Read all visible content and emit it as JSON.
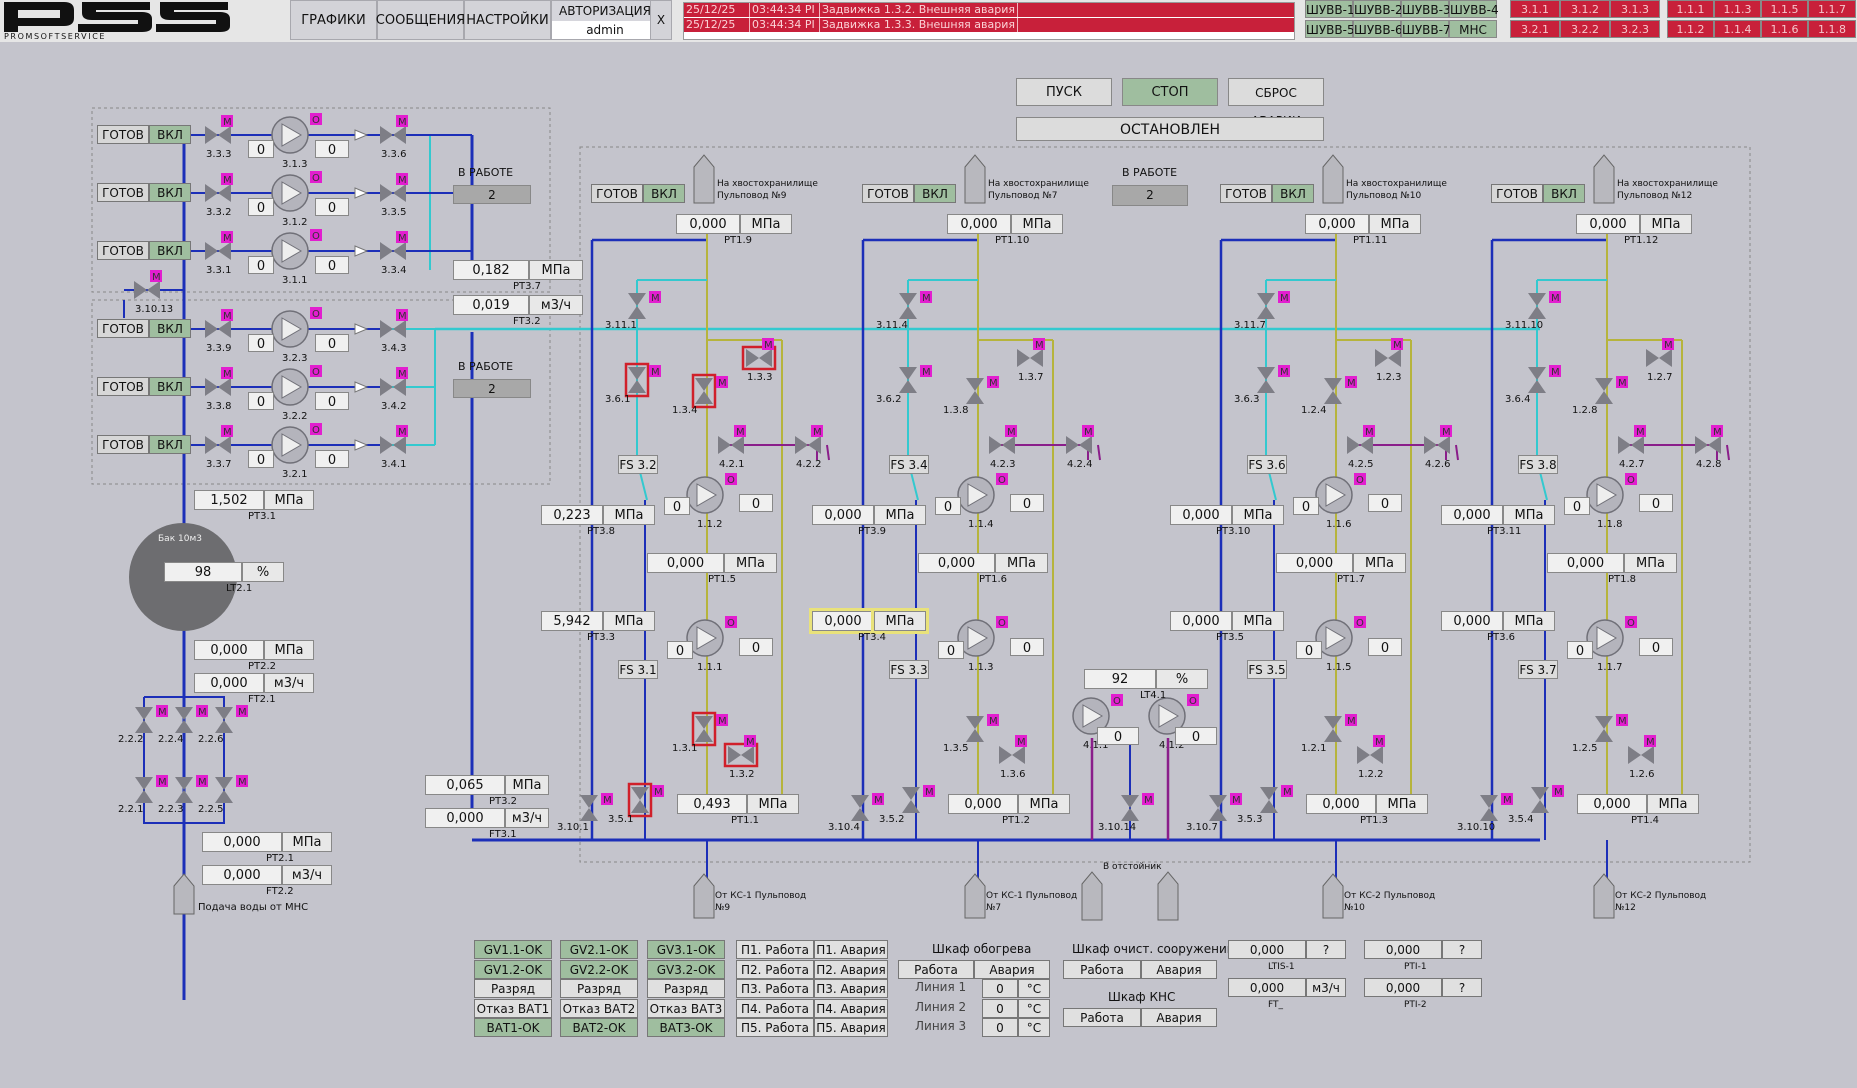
{
  "logo": {
    "text": "PSS",
    "sub": "PROMSOFTSERVICE"
  },
  "menu": {
    "graphs": "ГРАФИКИ",
    "messages": "СООБЩЕНИЯ",
    "settings": "НАСТРОЙКИ",
    "auth_label": "АВТОРИЗАЦИЯ",
    "user": "admin",
    "close": "X"
  },
  "alarms": [
    {
      "date": "25/12/25",
      "time": "03:44:34 PI",
      "text": "Задвижка 1.3.2. Внешняя авария"
    },
    {
      "date": "25/12/25",
      "time": "03:44:34 PI",
      "text": "Задвижка 1.3.3. Внешняя авария"
    }
  ],
  "shuvv": [
    [
      "ШУВВ-1",
      "ШУВВ-2",
      "ШУВВ-3",
      "ШУВВ-4"
    ],
    [
      "ШУВВ-5",
      "ШУВВ-6",
      "ШУВВ-7",
      "МНС"
    ]
  ],
  "red_tags_a": [
    [
      "3.1.1",
      "3.1.2",
      "3.1.3"
    ],
    [
      "3.2.1",
      "3.2.2",
      "3.2.3"
    ]
  ],
  "red_tags_b": [
    [
      "1.1.1",
      "1.1.3",
      "1.1.5",
      "1.1.7"
    ],
    [
      "1.1.2",
      "1.1.4",
      "1.1.6",
      "1.1.8"
    ]
  ],
  "control": {
    "start": "ПУСК",
    "stop": "СТОП",
    "reset": "СБРОС АВАРИИ",
    "status": "ОСТАНОВЛЕН"
  },
  "colors": {
    "bg": "#c4c4cc",
    "alarm": "#c8203a",
    "ok": "#9fbe9f",
    "pipe_blue": "#1c2fb8",
    "pipe_cyan": "#33c9cf",
    "pipe_yellow": "#b6b43c",
    "pipe_purple": "#8a1e8a",
    "motor": "#e21ecf"
  },
  "common": {
    "ready": "ГОТОВ",
    "on": "ВКЛ",
    "mpa": "МПа",
    "m3h": "м3/ч",
    "pct": "%",
    "in_work": "В РАБОТЕ",
    "zero_int": "0",
    "q": "?"
  },
  "left_pumps": [
    {
      "valve_in": "3.3.3",
      "pump": "3.1.3",
      "valve_out": "3.3.6"
    },
    {
      "valve_in": "3.3.2",
      "pump": "3.1.2",
      "valve_out": "3.3.5"
    },
    {
      "valve_in": "3.3.1",
      "pump": "3.1.1",
      "valve_out": "3.3.4"
    },
    {
      "valve_in": "3.3.9",
      "pump": "3.2.3",
      "valve_out": "3.4.3"
    },
    {
      "valve_in": "3.3.8",
      "pump": "3.2.2",
      "valve_out": "3.4.2"
    },
    {
      "valve_in": "3.3.7",
      "pump": "3.2.1",
      "valve_out": "3.4.1"
    }
  ],
  "left_misc": {
    "valve_3_10_13": "3.10.13",
    "in_work_1": "2",
    "in_work_2": "2",
    "pt37": {
      "value": "0,182",
      "name": "PT3.7"
    },
    "ft32": {
      "value": "0,019",
      "name": "FT3.2"
    },
    "pt31": {
      "value": "1,502",
      "name": "PT3.1"
    },
    "tank_title": "Бак 10м3",
    "lt21": {
      "value": "98",
      "name": "LT2.1"
    },
    "pt22": {
      "value": "0,000",
      "name": "PT2.2"
    },
    "ft21": {
      "value": "0,000",
      "name": "FT2.1"
    },
    "valves_22": [
      "2.2.2",
      "2.2.4",
      "2.2.6",
      "2.2.1",
      "2.2.3",
      "2.2.5"
    ],
    "pt21": {
      "value": "0,000",
      "name": "PT2.1"
    },
    "ft22": {
      "value": "0,000",
      "name": "FT2.2"
    },
    "supply": "Подача воды от МНС",
    "pt32": {
      "value": "0,065",
      "name": "PT3.2"
    },
    "ft31": {
      "value": "0,000",
      "name": "FT3.1"
    }
  },
  "lines": [
    {
      "dest": "На хвостохранилище Пульповод №9",
      "pt_top": {
        "value": "0,000",
        "name": "PT1.9"
      },
      "v_11": "3.11.1",
      "v_6": "3.6.1",
      "v_ab": [
        "1.3.4",
        "1.3.3"
      ],
      "fs_top": "FS 3.2",
      "v_2x": [
        "4.2.1",
        "4.2.2"
      ],
      "pump_top": "1.1.2",
      "pt_left_top": {
        "value": "0,223",
        "name": "PT3.8"
      },
      "pt_mid": {
        "value": "0,000",
        "name": "PT1.5"
      },
      "pump_bot": "1.1.1",
      "pt_left_bot": {
        "value": "5,942",
        "name": "PT3.3"
      },
      "fs_bot": "FS 3.1",
      "v_bot": [
        "1.3.1",
        "1.3.2"
      ],
      "v_10": "3.10.1",
      "v_5": "3.5.1",
      "pt_bot": {
        "value": "0,493",
        "name": "PT1.1"
      },
      "src": "От КС-1 Пульповод №9"
    },
    {
      "dest": "На хвостохранилище Пульповод №7",
      "pt_top": {
        "value": "0,000",
        "name": "PT1.10"
      },
      "v_11": "3.11.4",
      "v_6": "3.6.2",
      "v_ab": [
        "1.3.8",
        "1.3.7"
      ],
      "fs_top": "FS 3.4",
      "v_2x": [
        "4.2.3",
        "4.2.4"
      ],
      "pump_top": "1.1.4",
      "pt_left_top": {
        "value": "0,000",
        "name": "PT3.9"
      },
      "pt_mid": {
        "value": "0,000",
        "name": "PT1.6"
      },
      "pump_bot": "1.1.3",
      "pt_left_bot": {
        "value": "0,000",
        "name": "PT3.4"
      },
      "fs_bot": "FS 3.3",
      "v_bot": [
        "1.3.5",
        "1.3.6"
      ],
      "v_10": "3.10.4",
      "v_5": "3.5.2",
      "pt_bot": {
        "value": "0,000",
        "name": "PT1.2"
      },
      "src": "От КС-1 Пульповод №7"
    },
    {
      "dest": "На хвостохранилище Пульповод №10",
      "pt_top": {
        "value": "0,000",
        "name": "PT1.11"
      },
      "v_11": "3.11.7",
      "v_6": "3.6.3",
      "v_ab": [
        "1.2.4",
        "1.2.3"
      ],
      "fs_top": "FS 3.6",
      "v_2x": [
        "4.2.5",
        "4.2.6"
      ],
      "pump_top": "1.1.6",
      "pt_left_top": {
        "value": "0,000",
        "name": "PT3.10"
      },
      "pt_mid": {
        "value": "0,000",
        "name": "PT1.7"
      },
      "pump_bot": "1.1.5",
      "pt_left_bot": {
        "value": "0,000",
        "name": "PT3.5"
      },
      "fs_bot": "FS 3.5",
      "v_bot": [
        "1.2.1",
        "1.2.2"
      ],
      "v_10": "3.10.7",
      "v_5": "3.5.3",
      "pt_bot": {
        "value": "0,000",
        "name": "PT1.3"
      },
      "src": "От КС-2 Пульповод №10"
    },
    {
      "dest": "На хвостохранилище Пульповод №12",
      "pt_top": {
        "value": "0,000",
        "name": "PT1.12"
      },
      "v_11": "3.11.10",
      "v_6": "3.6.4",
      "v_ab": [
        "1.2.8",
        "1.2.7"
      ],
      "fs_top": "FS 3.8",
      "v_2x": [
        "4.2.7",
        "4.2.8"
      ],
      "pump_top": "1.1.8",
      "pt_left_top": {
        "value": "0,000",
        "name": "PT3.11"
      },
      "pt_mid": {
        "value": "0,000",
        "name": "PT1.8"
      },
      "pump_bot": "1.1.7",
      "pt_left_bot": {
        "value": "0,000",
        "name": "PT3.6"
      },
      "fs_bot": "FS 3.7",
      "v_bot": [
        "1.2.5",
        "1.2.6"
      ],
      "v_10": "3.10.10",
      "v_5": "3.5.4",
      "pt_bot": {
        "value": "0,000",
        "name": "PT1.4"
      },
      "src": "От КС-2 Пульповод №12"
    }
  ],
  "center": {
    "in_work": "В РАБОТЕ",
    "in_work_val": "2",
    "lt41": {
      "value": "92",
      "name": "LT4.1"
    },
    "pump_a": "4.1.1",
    "pump_b": "4.1.2",
    "valve": "3.10.14",
    "sump": "В отстойник"
  },
  "bottom": {
    "gv": [
      [
        "GV1.1-OK",
        "GV1.2-OK",
        "Разряд ВАТ1",
        "Отказ ВАТ1",
        "ВАТ1-OK"
      ],
      [
        "GV2.1-OK",
        "GV2.2-OK",
        "Разряд ВАТ2",
        "Отказ ВАТ2",
        "ВАТ2-OK"
      ],
      [
        "GV3.1-OK",
        "GV3.2-OK",
        "Разряд ВАТ3",
        "Отказ ВАТ3",
        "ВАТ3-OK"
      ]
    ],
    "p_work": [
      "П1. Работа",
      "П2. Работа",
      "П3. Работа",
      "П4. Работа",
      "П5. Работа"
    ],
    "p_alarm": [
      "П1. Авария",
      "П2. Авария",
      "П3. Авария",
      "П4. Авария",
      "П5. Авария"
    ],
    "heat": {
      "title": "Шкаф обогрева",
      "work": "Работа",
      "alarm": "Авария",
      "lines": [
        "Линия 1",
        "Линия 2",
        "Линия 3"
      ],
      "vals": [
        "0",
        "0",
        "0"
      ],
      "unit": "°C"
    },
    "clean": {
      "title": "Шкаф очист. сооружений",
      "work": "Работа",
      "alarm": "Авария"
    },
    "kns": {
      "title": "Шкаф КНС",
      "work": "Работа",
      "alarm": "Авария"
    },
    "ltis": {
      "value": "0,000",
      "unit": "?",
      "name": "LTIS-1"
    },
    "pti1": {
      "value": "0,000",
      "unit": "?",
      "name": "PTI-1"
    },
    "ft": {
      "value": "0,000",
      "unit": "м3/ч",
      "name": "FT_"
    },
    "pti2": {
      "value": "0,000",
      "unit": "?",
      "name": "PTI-2"
    }
  }
}
